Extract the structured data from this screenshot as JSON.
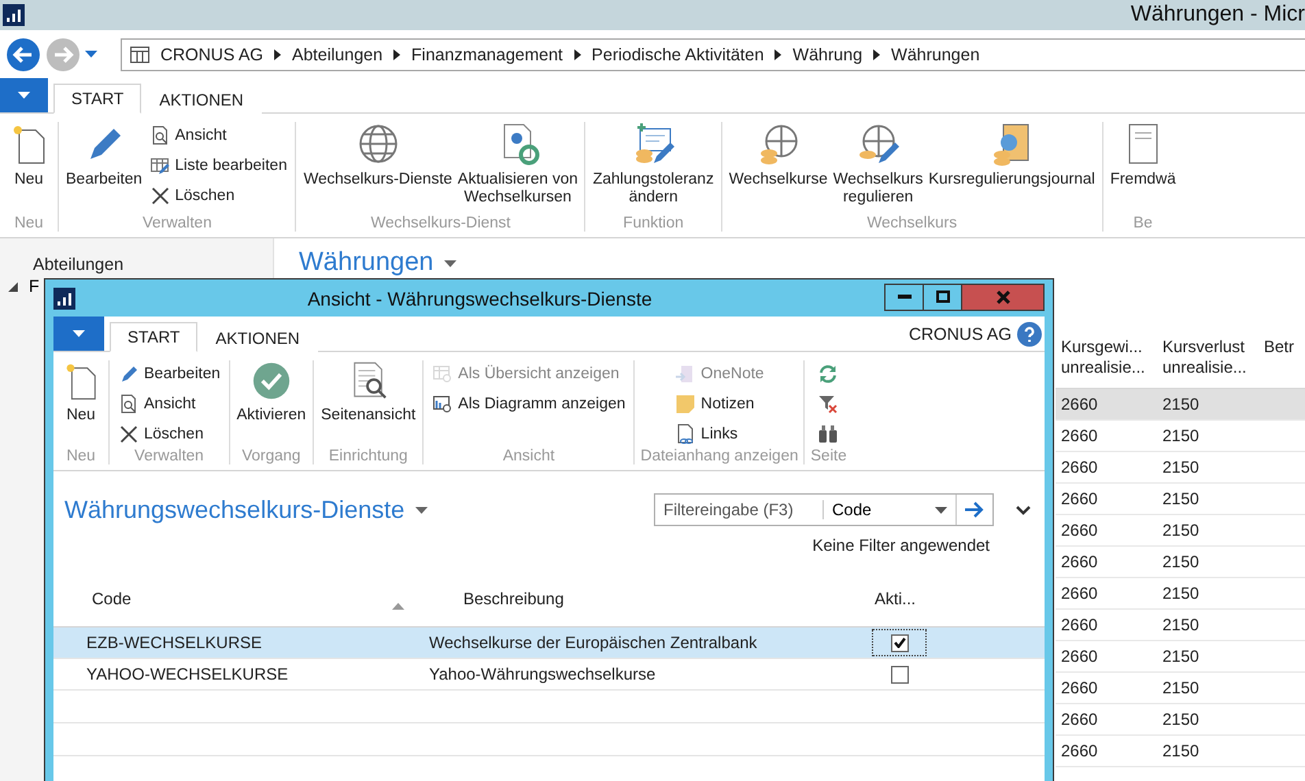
{
  "window": {
    "title": "Währungen - Micr"
  },
  "breadcrumb": [
    "CRONUS AG",
    "Abteilungen",
    "Finanzmanagement",
    "Periodische Aktivitäten",
    "Währung",
    "Währungen"
  ],
  "ribbon": {
    "tabs": [
      {
        "label": "START",
        "selected": true
      },
      {
        "label": "AKTIONEN",
        "selected": false
      }
    ],
    "groups": [
      {
        "label": "Neu",
        "items": [
          {
            "kind": "large",
            "label": "Neu",
            "disabled": false
          }
        ]
      },
      {
        "label": "Verwalten",
        "items": [
          {
            "kind": "large",
            "label": "Bearbeiten",
            "disabled": false
          },
          {
            "kind": "small",
            "label": "Ansicht",
            "disabled": false
          },
          {
            "kind": "small",
            "label": "Liste bearbeiten",
            "disabled": false
          },
          {
            "kind": "small",
            "label": "Löschen",
            "disabled": false
          }
        ]
      },
      {
        "label": "Wechselkurs-Dienst",
        "items": [
          {
            "kind": "large",
            "label": "Wechselkurs-Dienste",
            "disabled": false
          },
          {
            "kind": "large",
            "label": "Aktualisieren von\nWechselkursen",
            "disabled": false
          }
        ]
      },
      {
        "label": "Funktion",
        "items": [
          {
            "kind": "large",
            "label": "Zahlungstoleranz\nändern",
            "disabled": false
          }
        ]
      },
      {
        "label": "Wechselkurs",
        "items": [
          {
            "kind": "large",
            "label": "Wechselkurse",
            "disabled": false
          },
          {
            "kind": "large",
            "label": "Wechselkurs\nregulieren",
            "disabled": false
          },
          {
            "kind": "large",
            "label": "Kursregulierungsjournal",
            "disabled": false
          }
        ]
      },
      {
        "label": "Be",
        "items": [
          {
            "kind": "large",
            "label": "Fremdwä",
            "disabled": false
          }
        ]
      }
    ]
  },
  "navigation": {
    "header": "Abteilungen",
    "tree": [
      {
        "label": "F",
        "expanded": true
      }
    ]
  },
  "page": {
    "title": "Währungen",
    "columns": [
      "Kursgewi...\nunrealisie...",
      "Kursverlust\nunrealisie...",
      "Betr"
    ],
    "rows": [
      {
        "cells": [
          "2660",
          "2150"
        ],
        "selected": true
      },
      {
        "cells": [
          "2660",
          "2150"
        ],
        "selected": false
      },
      {
        "cells": [
          "2660",
          "2150"
        ],
        "selected": false
      },
      {
        "cells": [
          "2660",
          "2150"
        ],
        "selected": false
      },
      {
        "cells": [
          "2660",
          "2150"
        ],
        "selected": false
      },
      {
        "cells": [
          "2660",
          "2150"
        ],
        "selected": false
      },
      {
        "cells": [
          "2660",
          "2150"
        ],
        "selected": false
      },
      {
        "cells": [
          "2660",
          "2150"
        ],
        "selected": false
      },
      {
        "cells": [
          "2660",
          "2150"
        ],
        "selected": false
      },
      {
        "cells": [
          "2660",
          "2150"
        ],
        "selected": false
      },
      {
        "cells": [
          "2660",
          "2150"
        ],
        "selected": false
      },
      {
        "cells": [
          "2660",
          "2150"
        ],
        "selected": false
      }
    ]
  },
  "dialog": {
    "title": "Ansicht - Währungswechselkurs-Dienste",
    "company": "CRONUS AG",
    "tabs": [
      {
        "label": "START",
        "selected": true
      },
      {
        "label": "AKTIONEN",
        "selected": false
      }
    ],
    "groups": [
      {
        "label": "Neu",
        "items": [
          {
            "kind": "large",
            "label": "Neu",
            "disabled": false
          }
        ]
      },
      {
        "label": "Verwalten",
        "items": [
          {
            "kind": "small",
            "label": "Bearbeiten",
            "disabled": false
          },
          {
            "kind": "small",
            "label": "Ansicht",
            "disabled": false
          },
          {
            "kind": "small",
            "label": "Löschen",
            "disabled": false
          }
        ]
      },
      {
        "label": "Vorgang",
        "items": [
          {
            "kind": "large",
            "label": "Aktivieren",
            "disabled": false
          }
        ]
      },
      {
        "label": "Einrichtung",
        "items": [
          {
            "kind": "large",
            "label": "Seitenansicht",
            "disabled": false
          }
        ]
      },
      {
        "label": "Ansicht",
        "items": [
          {
            "kind": "small",
            "label": "Als Übersicht anzeigen",
            "disabled": true
          },
          {
            "kind": "small",
            "label": "Als Diagramm anzeigen",
            "disabled": false
          }
        ]
      },
      {
        "label": "Dateianhang anzeigen",
        "items": [
          {
            "kind": "small",
            "label": "OneNote",
            "disabled": true
          },
          {
            "kind": "small",
            "label": "Notizen",
            "disabled": false
          },
          {
            "kind": "small",
            "label": "Links",
            "disabled": false
          }
        ]
      },
      {
        "label": "Seite",
        "items": [
          {
            "kind": "icon",
            "disabled": false
          },
          {
            "kind": "icon",
            "disabled": false
          },
          {
            "kind": "icon",
            "disabled": false
          }
        ]
      }
    ],
    "list_title": "Währungswechselkurs-Dienste",
    "filter": {
      "placeholder": "Filtereingabe (F3)",
      "field": "Code"
    },
    "filter_status": "Keine Filter angewendet",
    "columns": [
      {
        "label": "Code",
        "sorted": true
      },
      {
        "label": "Beschreibung",
        "sorted": false
      },
      {
        "label": "Akti...",
        "sorted": false
      }
    ],
    "rows": [
      {
        "code": "EZB-WECHSELKURSE",
        "description": "Wechselkurse der Europäischen Zentralbank",
        "active": true,
        "selected": true
      },
      {
        "code": "YAHOO-WECHSELKURSE",
        "description": "Yahoo-Währungswechselkurse",
        "active": false,
        "selected": false
      }
    ]
  }
}
